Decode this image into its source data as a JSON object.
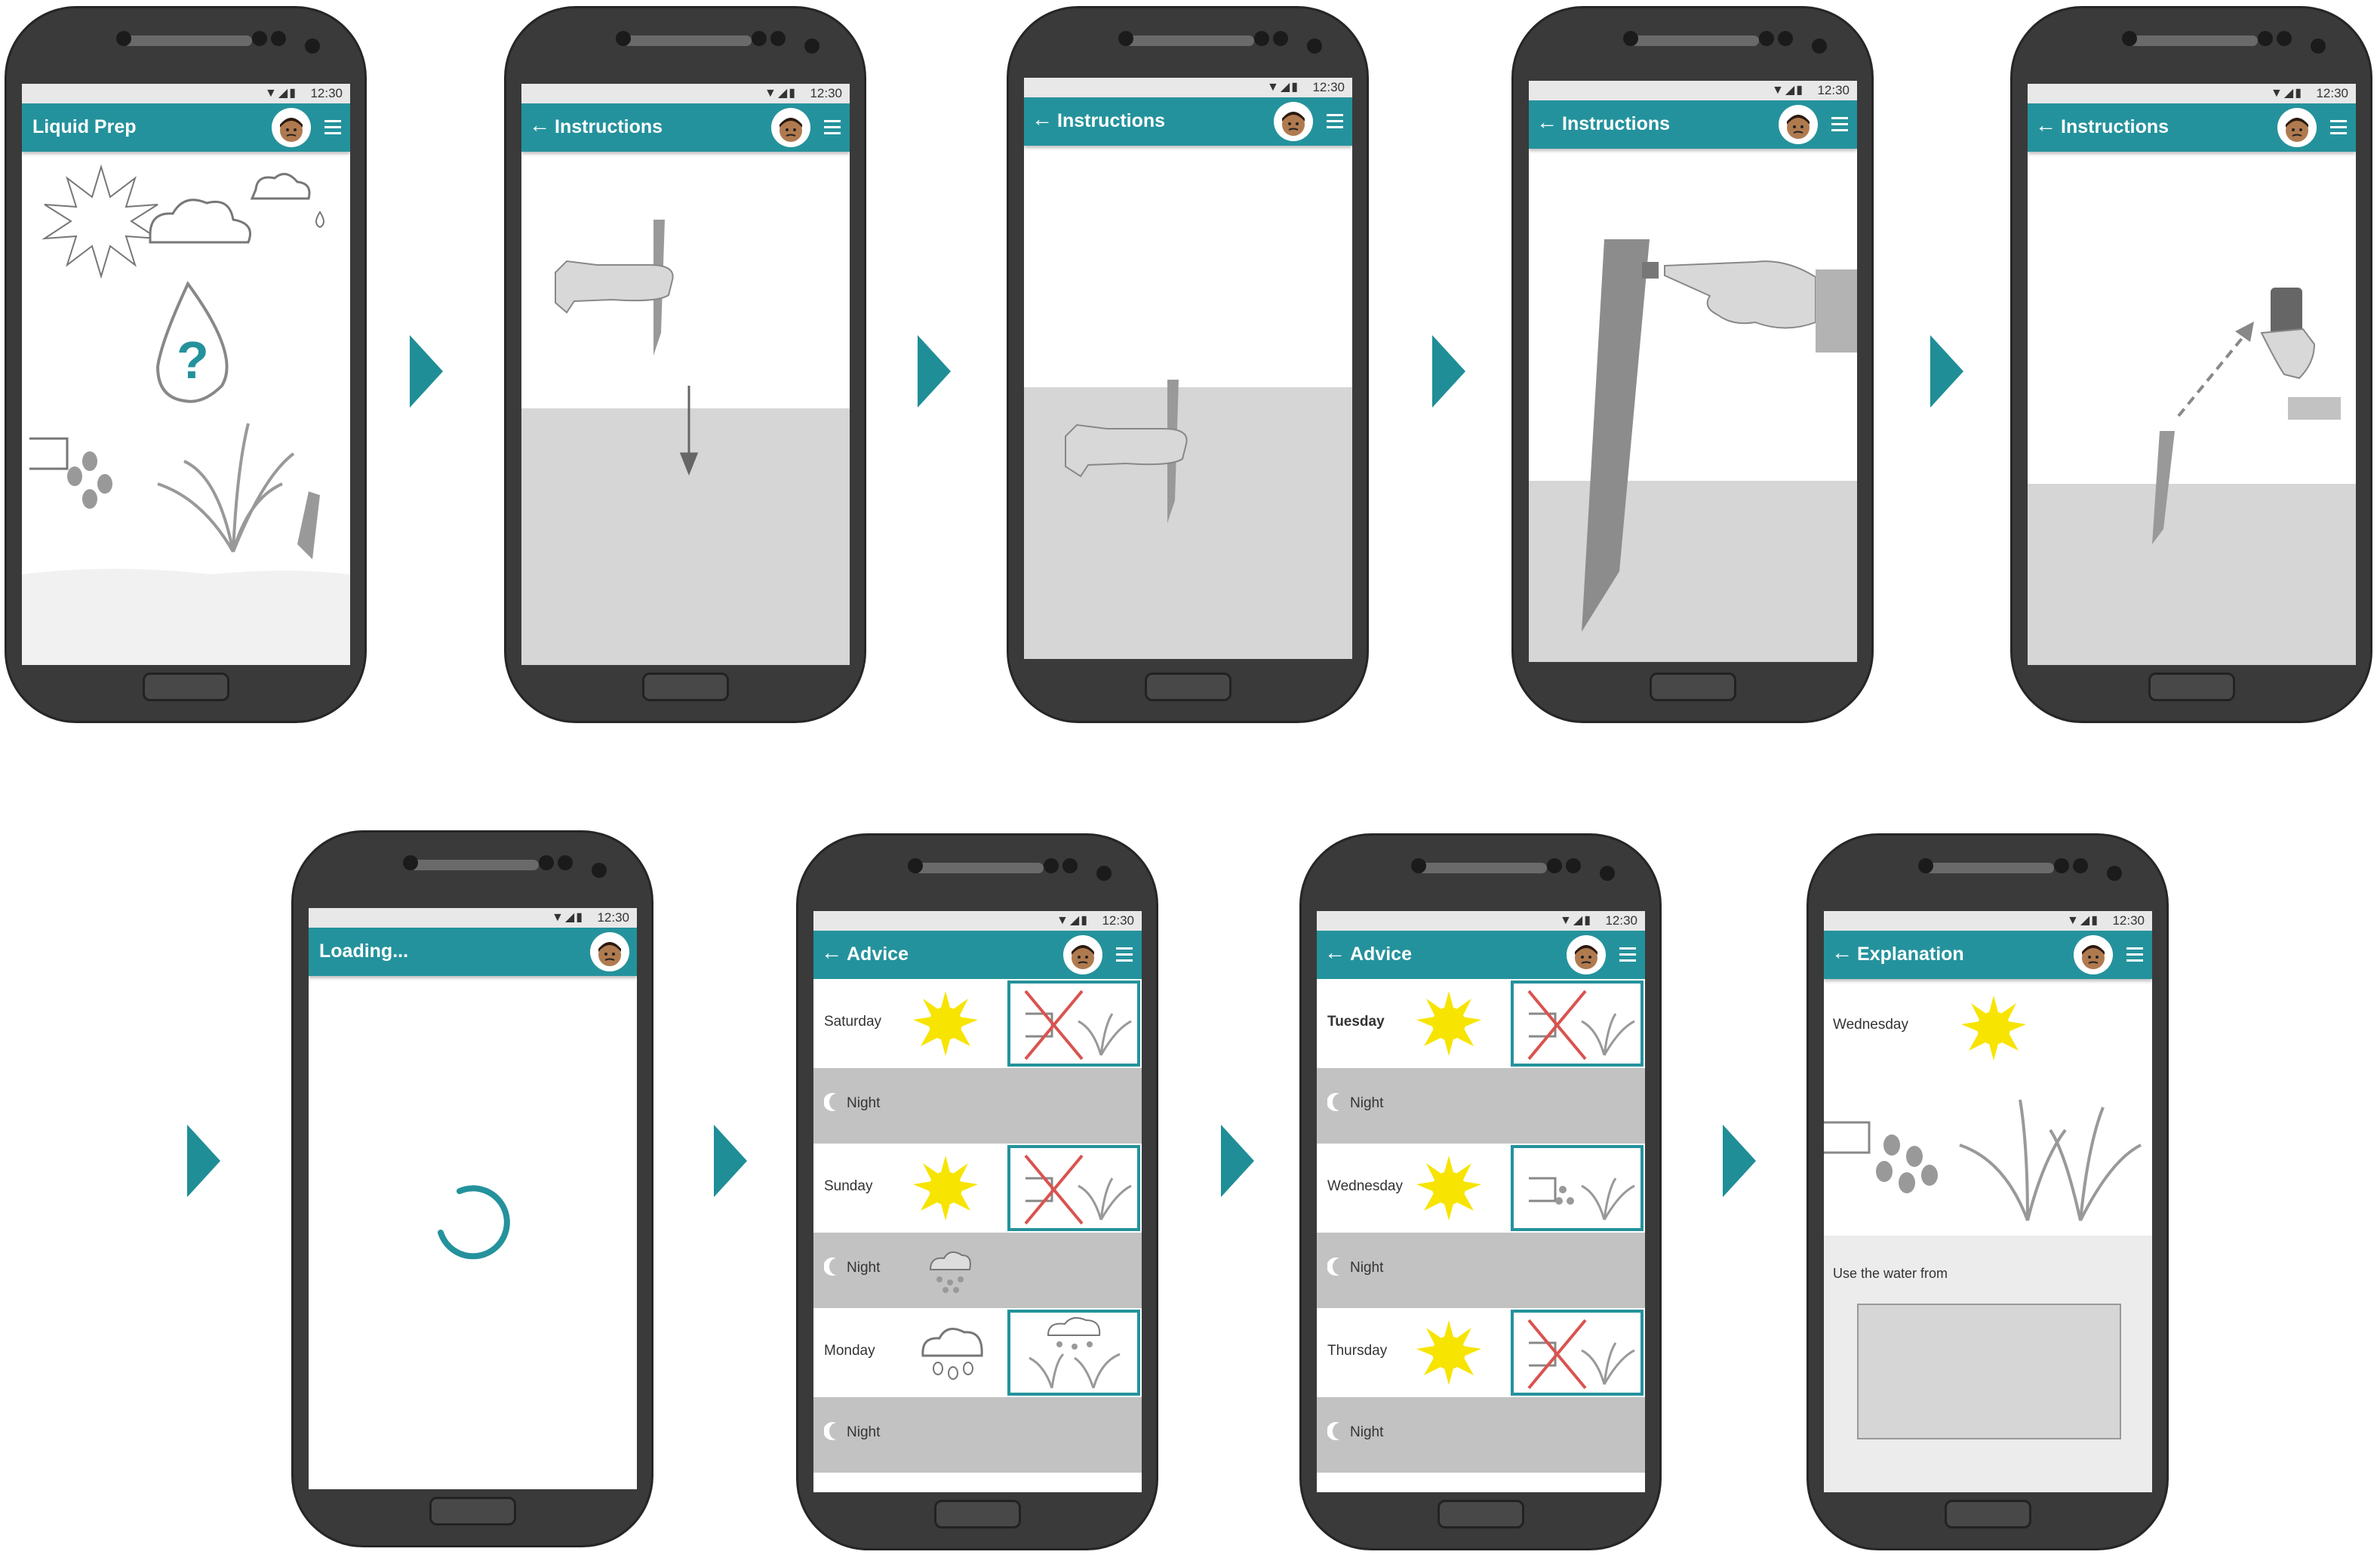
{
  "status": {
    "time": "12:30",
    "signal": "▼◢▮"
  },
  "screens": [
    {
      "title": "Liquid Prep",
      "back": false
    },
    {
      "title": "Instructions",
      "back": true
    },
    {
      "title": "Instructions",
      "back": true
    },
    {
      "title": "Instructions",
      "back": true
    },
    {
      "title": "Instructions",
      "back": true
    },
    {
      "title": "Loading...",
      "back": false
    },
    {
      "title": "Advice",
      "back": true
    },
    {
      "title": "Advice",
      "back": true
    },
    {
      "title": "Explanation",
      "back": true
    }
  ],
  "back_glyph": "←",
  "advice1": {
    "days": [
      "Saturday",
      "Sunday",
      "Monday"
    ],
    "night": "Night"
  },
  "advice2": {
    "days": [
      "Tuesday",
      "Wednesday",
      "Thursday"
    ],
    "night": "Night"
  },
  "explanation": {
    "day": "Wednesday",
    "text": "Use the water from"
  },
  "colors": {
    "teal": "#24929c",
    "arrow": "#1f8e97",
    "sun": "#f7e400",
    "cross": "#d9534f"
  },
  "icons": [
    "sun-icon",
    "cloud-icon",
    "water-drop-icon",
    "question-icon",
    "watering-can-icon",
    "grass-icon",
    "sensor-stake-icon",
    "hand-icon",
    "phone-icon",
    "moon-icon",
    "rain-cloud-icon",
    "spinner-icon",
    "menu-icon",
    "avatar-icon",
    "back-arrow-icon"
  ]
}
